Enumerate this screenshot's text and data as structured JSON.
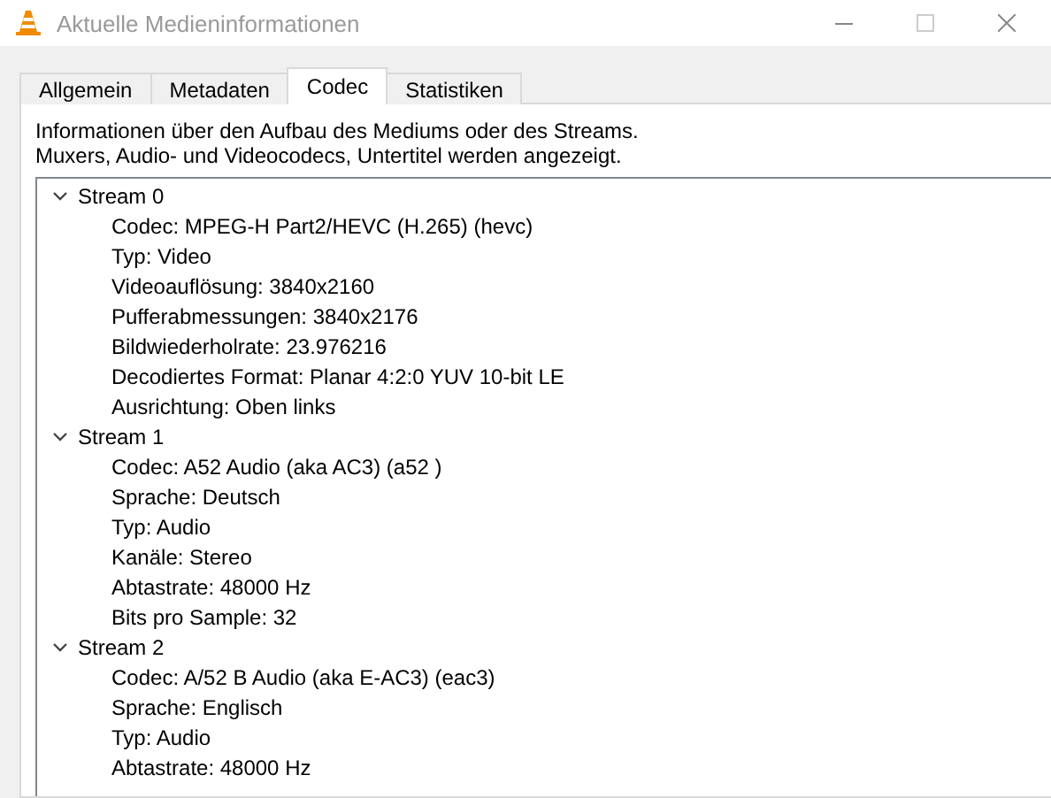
{
  "window": {
    "title": "Aktuelle Medieninformationen"
  },
  "tabs": [
    {
      "label": "Allgemein",
      "selected": false
    },
    {
      "label": "Metadaten",
      "selected": false
    },
    {
      "label": "Codec",
      "selected": true
    },
    {
      "label": "Statistiken",
      "selected": false
    }
  ],
  "description": [
    "Informationen über den Aufbau des Mediums oder des Streams.",
    "Muxers, Audio- und Videocodecs, Untertitel werden angezeigt."
  ],
  "tree": [
    {
      "label": "Stream 0",
      "expanded": true,
      "children": [
        "Codec: MPEG-H Part2/HEVC (H.265) (hevc)",
        "Typ: Video",
        "Videoauflösung: 3840x2160",
        "Pufferabmessungen: 3840x2176",
        "Bildwiederholrate: 23.976216",
        "Decodiertes Format: Planar 4:2:0 YUV 10-bit LE",
        "Ausrichtung: Oben links"
      ]
    },
    {
      "label": "Stream 1",
      "expanded": true,
      "children": [
        "Codec: A52 Audio (aka AC3) (a52 )",
        "Sprache: Deutsch",
        "Typ: Audio",
        "Kanäle: Stereo",
        "Abtastrate: 48000 Hz",
        "Bits pro Sample: 32"
      ]
    },
    {
      "label": "Stream 2",
      "expanded": true,
      "children": [
        "Codec: A/52 B Audio (aka E-AC3) (eac3)",
        "Sprache: Englisch",
        "Typ: Audio",
        "Abtastrate: 48000 Hz"
      ]
    }
  ]
}
